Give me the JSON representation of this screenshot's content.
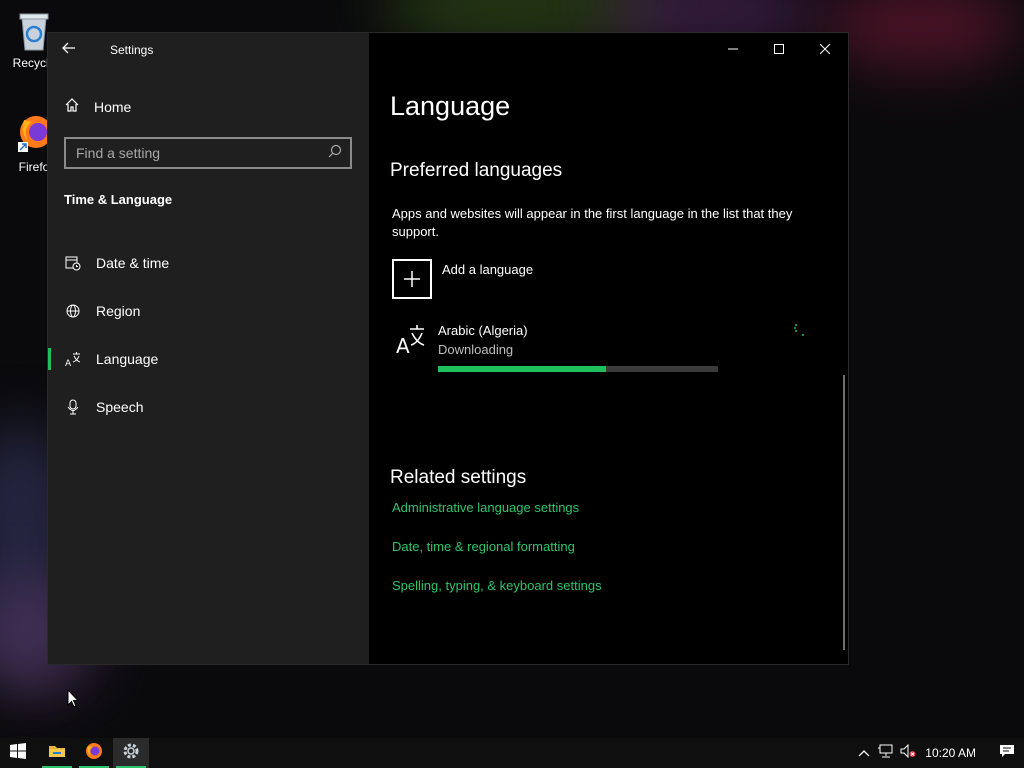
{
  "desktop": {
    "icons": [
      {
        "label": "Recycle",
        "icon": "recycle-bin-icon"
      },
      {
        "label": "Firefo",
        "icon": "firefox-icon"
      }
    ]
  },
  "window": {
    "title": "Settings",
    "caption": {
      "minimize": "minimize-icon",
      "maximize": "maximize-icon",
      "close": "close-icon"
    }
  },
  "sidebar": {
    "home_label": "Home",
    "search_placeholder": "Find a setting",
    "section_label": "Time & Language",
    "items": [
      {
        "label": "Date & time",
        "icon": "calendar-clock-icon",
        "active": false
      },
      {
        "label": "Region",
        "icon": "globe-icon",
        "active": false
      },
      {
        "label": "Language",
        "icon": "language-icon",
        "active": true
      },
      {
        "label": "Speech",
        "icon": "microphone-icon",
        "active": false
      }
    ]
  },
  "main": {
    "title": "Language",
    "preferred_heading": "Preferred languages",
    "preferred_desc": "Apps and websites will appear in the first language in the list that they support.",
    "add_language_label": "Add a language",
    "languages": [
      {
        "name": "Arabic (Algeria)",
        "status": "Downloading",
        "progress": 0.6
      }
    ],
    "related_heading": "Related settings",
    "related_links": [
      "Administrative language settings",
      "Date, time & regional formatting",
      "Spelling, typing, & keyboard settings"
    ]
  },
  "taskbar": {
    "apps": [
      "start-icon",
      "file-explorer-icon",
      "firefox-icon",
      "settings-icon"
    ],
    "time": "10:20 AM"
  },
  "colors": {
    "accent": "#1fbf5b",
    "link": "#2ec46b",
    "sidebar_bg": "#1f1f1f",
    "content_bg": "#000000"
  }
}
